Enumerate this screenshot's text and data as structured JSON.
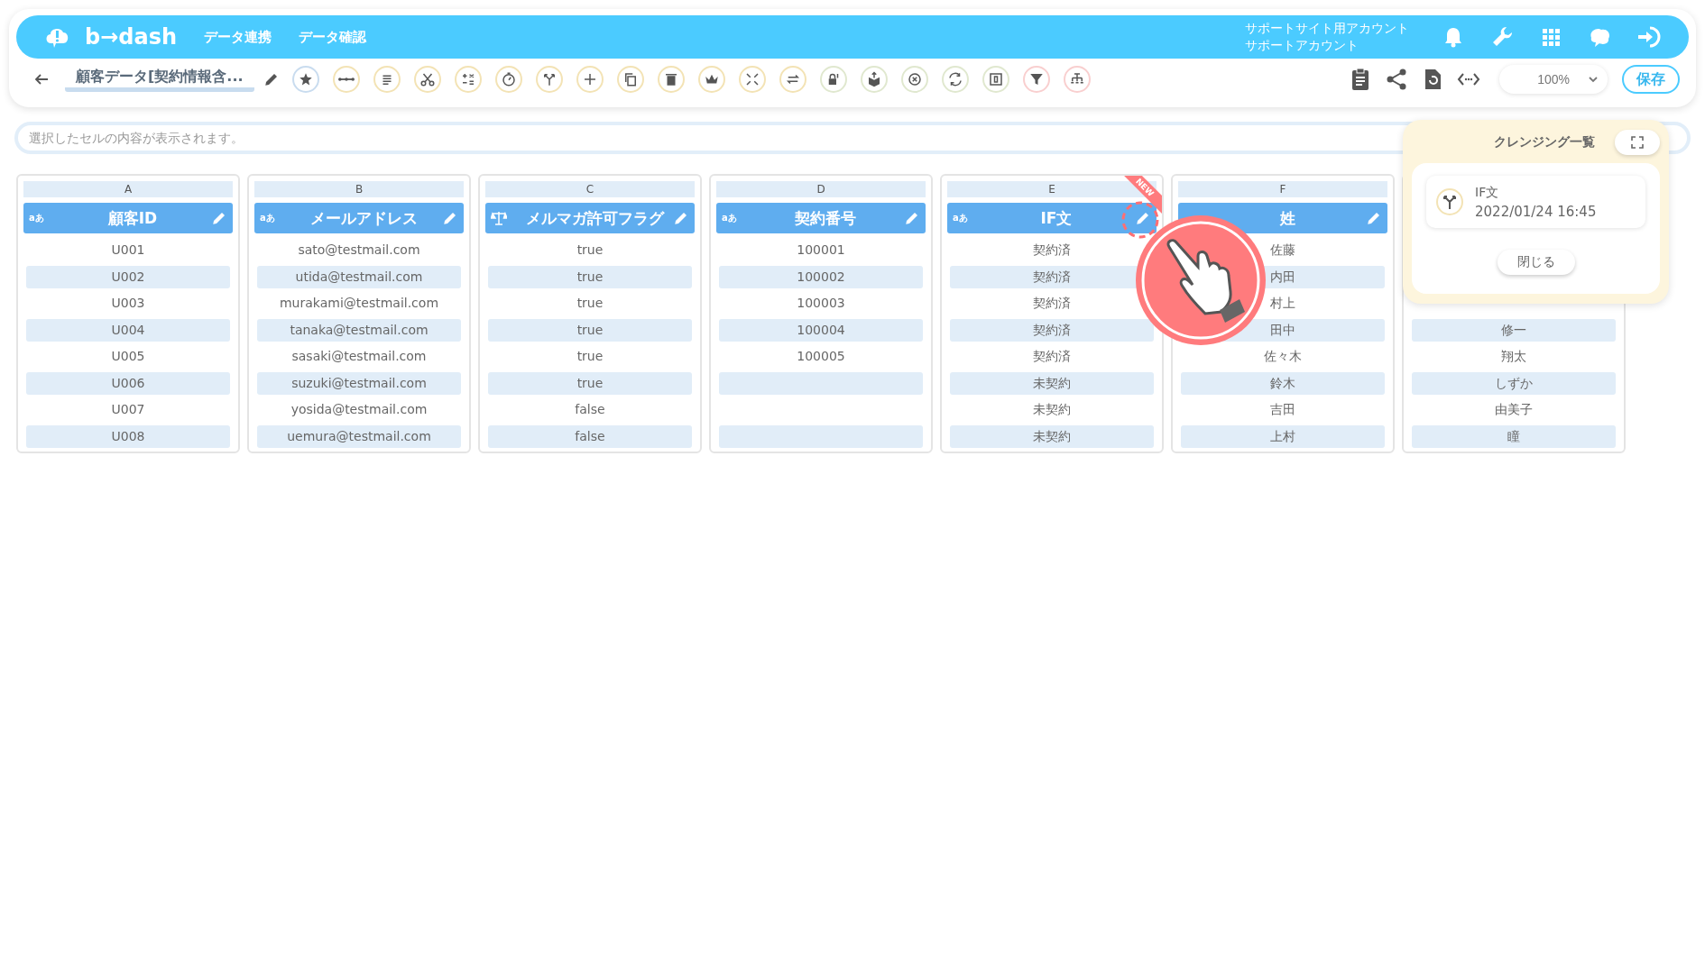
{
  "header": {
    "logo": "b→dash",
    "nav": [
      "データ連携",
      "データ確認"
    ],
    "account": [
      "サポートサイト用アカウント",
      "サポートアカウント"
    ]
  },
  "toolbar": {
    "title": "顧客データ[契約情報含...",
    "zoom": "100%",
    "save": "保存"
  },
  "formula_bar": {
    "placeholder": "選択したセルの内容が表示されます。"
  },
  "columns": [
    {
      "letter": "A",
      "title": "顧客ID",
      "kind": "text",
      "type_label": "aあ",
      "cells": [
        "U001",
        "U002",
        "U003",
        "U004",
        "U005",
        "U006",
        "U007",
        "U008"
      ]
    },
    {
      "letter": "B",
      "title": "メールアドレス",
      "kind": "text",
      "type_label": "aあ",
      "cells": [
        "sato@testmail.com",
        "utida@testmail.com",
        "murakami@testmail.com",
        "tanaka@testmail.com",
        "sasaki@testmail.com",
        "suzuki@testmail.com",
        "yosida@testmail.com",
        "uemura@testmail.com"
      ]
    },
    {
      "letter": "C",
      "title": "メルマガ許可フラグ",
      "kind": "boolean",
      "cells": [
        "true",
        "true",
        "true",
        "true",
        "true",
        "true",
        "false",
        "false"
      ]
    },
    {
      "letter": "D",
      "title": "契約番号",
      "kind": "text",
      "type_label": "aあ",
      "cells": [
        "100001",
        "100002",
        "100003",
        "100004",
        "100005",
        null,
        null,
        null
      ]
    },
    {
      "letter": "E",
      "title": "IF文",
      "kind": "text",
      "type_label": "aあ",
      "badge": "NEW",
      "cells": [
        "契約済",
        "契約済",
        "契約済",
        "契約済",
        "契約済",
        "未契約",
        "未契約",
        "未契約"
      ]
    },
    {
      "letter": "F",
      "title": "姓",
      "kind": "text",
      "cells": [
        "佐藤",
        "内田",
        "村上",
        "田中",
        "佐々木",
        "鈴木",
        "吉田",
        "上村"
      ]
    },
    {
      "kind": "text",
      "cells": [
        null,
        null,
        null,
        "修一",
        "翔太",
        "しずか",
        "由美子",
        "瞳"
      ]
    }
  ],
  "cleansing_panel": {
    "title": "クレンジング一覧",
    "items": [
      {
        "name": "IF文",
        "date": "2022/01/24 16:45"
      }
    ],
    "close": "閉じる"
  }
}
